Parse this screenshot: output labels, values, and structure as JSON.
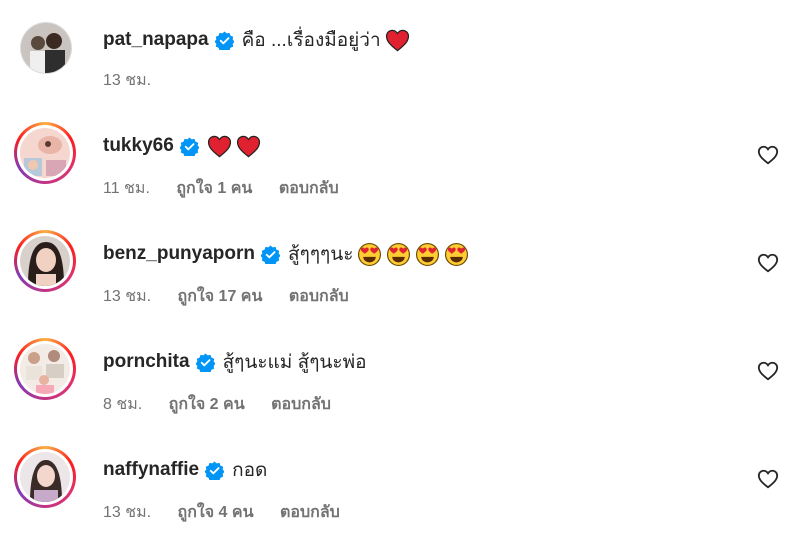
{
  "comments": [
    {
      "username": "pat_napapa",
      "text": "คือ ...เรื่องมือยู่ว่า",
      "emojis": [
        "red-heart"
      ],
      "time": "13 ชม.",
      "likes": "",
      "reply": "",
      "avatar_style": "plain"
    },
    {
      "username": "tukky66",
      "text": "",
      "emojis": [
        "red-heart",
        "red-heart"
      ],
      "time": "11 ชม.",
      "likes": "ถูกใจ 1 คน",
      "reply": "ตอบกลับ",
      "avatar_style": "story"
    },
    {
      "username": "benz_punyaporn",
      "text": "สู้ๆๆๆนะ",
      "emojis": [
        "heart-eyes",
        "heart-eyes",
        "heart-eyes",
        "heart-eyes"
      ],
      "time": "13 ชม.",
      "likes": "ถูกใจ 17 คน",
      "reply": "ตอบกลับ",
      "avatar_style": "story"
    },
    {
      "username": "pornchita",
      "text": "สู้ๆนะแม่ สู้ๆนะพ่อ",
      "emojis": [],
      "time": "8 ชม.",
      "likes": "ถูกใจ 2 คน",
      "reply": "ตอบกลับ",
      "avatar_style": "story"
    },
    {
      "username": "naffynaffie",
      "text": "กอด",
      "emojis": [],
      "time": "13 ชม.",
      "likes": "ถูกใจ 4 คน",
      "reply": "ตอบกลับ",
      "avatar_style": "story"
    }
  ],
  "colors": {
    "verified": "#0095f6",
    "meta_text": "#737373",
    "username": "#262626",
    "story_ring": "#e1306c"
  }
}
